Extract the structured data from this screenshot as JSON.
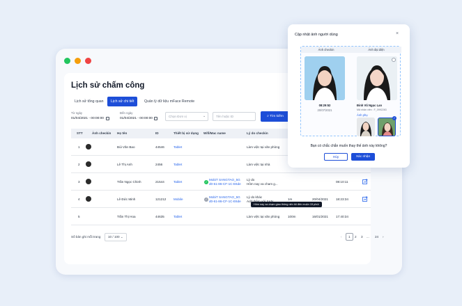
{
  "title": "Lịch sử chấm công",
  "tabs": [
    {
      "label": "Lịch sử tổng quan"
    },
    {
      "label": "Lịch sử chi tiết"
    },
    {
      "label": "Quản lý dữ liệu mFace Remote"
    }
  ],
  "filters": {
    "from_label": "Từ ngày",
    "from_value": "01/04/2021 - 00:00:00",
    "to_label": "Đến ngày",
    "to_value": "01/04/2021 - 00:00:00",
    "unit_placeholder": "Chọn Đơn vị",
    "search_placeholder": "Tên hoặc ID",
    "search_button": "Tìm kiếm"
  },
  "table": {
    "columns": [
      "STT",
      "Ảnh checkin",
      "Họ tên",
      "ID",
      "Thiết bị sử dụng",
      "Wifi/Mac name",
      "Lý do checkin"
    ],
    "rows": [
      {
        "stt": "1",
        "name": "Bùi Văn Bao",
        "id": "44546",
        "device": "Tablet",
        "wifi_1": "",
        "wifi_2": "",
        "reason_1": "Làm việc tại văn phòng",
        "reason_2": "",
        "distance": "",
        "date": "",
        "time": ""
      },
      {
        "stt": "2",
        "name": "Lê Thị Anh",
        "id": "2456",
        "device": "Tablet",
        "wifi_1": "",
        "wifi_2": "",
        "reason_1": "Làm việc tại nhà",
        "reason_2": "",
        "distance": "",
        "date": "",
        "time": ""
      },
      {
        "stt": "3",
        "name": "Trần Ngọc Chinh",
        "id": "21544",
        "device": "Tablet",
        "wifi_1": "MobiT SANGTAO_5G",
        "wifi_2": "d0-61-86-CF-1C-E6de",
        "reason_1": "Lý do",
        "reason_2": "Hôm nay va cham g...",
        "distance": "",
        "date": "",
        "time": "08:10:11"
      },
      {
        "stt": "4",
        "name": "Lê Đức Minh",
        "id": "121212",
        "device": "Mobile",
        "wifi_1": "MobiT SANGTAO_5G",
        "wifi_2": "d0-61-86-CF-1C-E6de",
        "reason_1": "Lý do khác",
        "reason_2": "Add thêm với SAN...",
        "distance": "1m",
        "date": "20/04/2021",
        "time": "18:23:34"
      },
      {
        "stt": "5",
        "name": "Trần Thị Hoa",
        "id": "44635",
        "device": "Tablet",
        "wifi_1": "",
        "wifi_2": "",
        "reason_1": "Làm việc tại văn phòng",
        "reason_2": "",
        "distance": "100m",
        "date": "16/01/2021",
        "time": "17:40:34"
      }
    ]
  },
  "tooltip": "Hôm nay va chạm giao thông nên tôi đến muộn 15 phút",
  "footer": {
    "per_page_label": "Số bản ghi mỗi trang",
    "per_page_value": "10 / 100",
    "pages": [
      "1",
      "2",
      "3",
      "...",
      "24"
    ]
  },
  "modal": {
    "title": "Cập nhật ảnh người dùng",
    "checkin_col": "Ảnh checkin",
    "rep_col": "Ảnh đại diện",
    "checkin_time": "08:29:52",
    "checkin_date": "20/07/2021",
    "person_name": "Đinh Vũ Ngọc Lan",
    "employee_code": "Mã nhân viên : F_0992283",
    "extra_label": "Ảnh phụ",
    "question": "Bạn có chắc chắn muốn thay thế ảnh này không?",
    "cancel": "Hủy",
    "confirm": "Xác nhận"
  },
  "colors": {
    "primary": "#1d4ed8",
    "dot_green": "#22c55e",
    "dot_yellow": "#f59e0b",
    "dot_red": "#ef4444"
  }
}
